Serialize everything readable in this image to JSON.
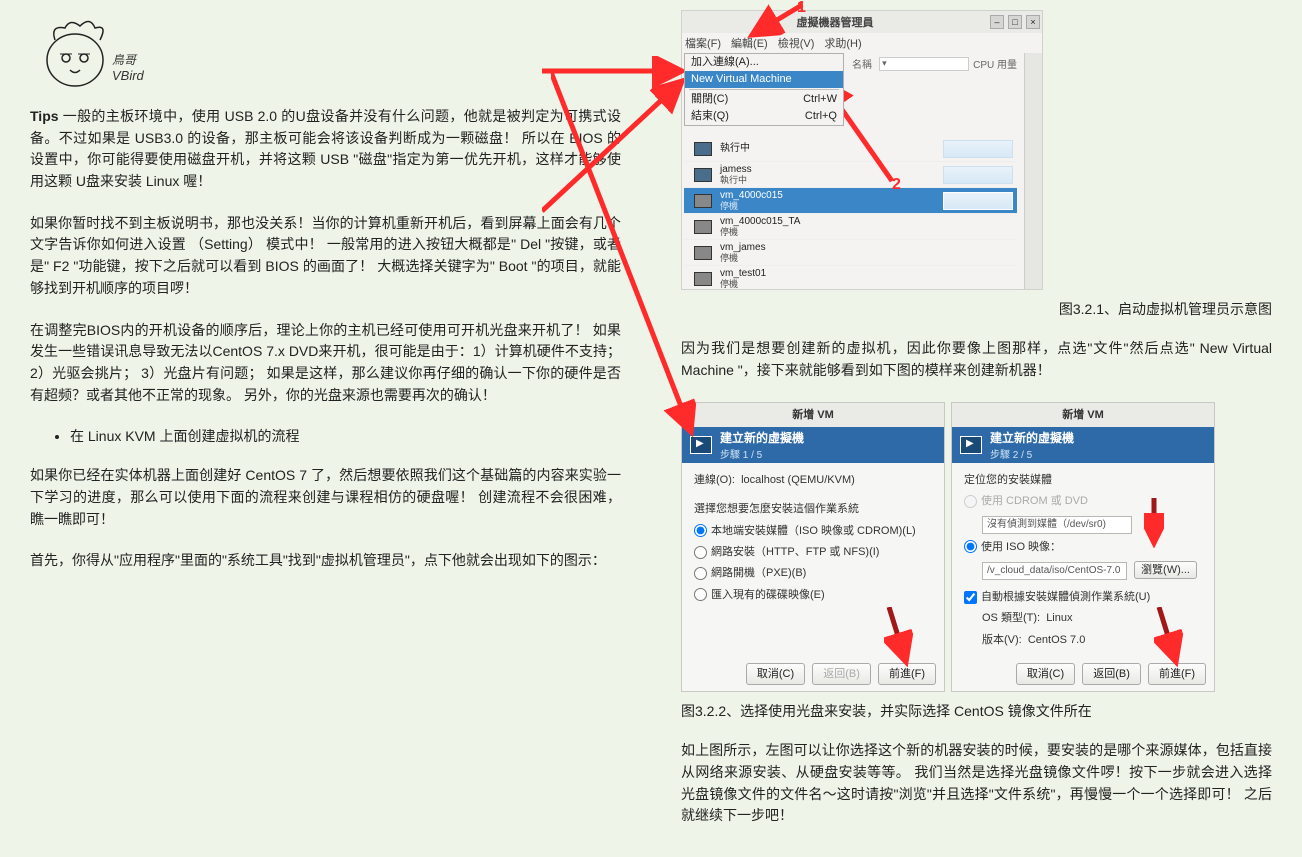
{
  "left": {
    "tips_label": "Tips",
    "p1": "一般的主板环境中，使用 USB 2.0 的U盘设备并没有什么问题，他就是被判定为可携式设备。不过如果是 USB3.0 的设备，那主板可能会将该设备判断成为一颗磁盘！ 所以在 BIOS 的设置中，你可能得要使用磁盘开机，并将这颗 USB \"磁盘\"指定为第一优先开机，这样才能够使用这颗 U盘来安装 Linux 喔！",
    "p2": "如果你暂时找不到主板说明书，那也没关系！当你的计算机重新开机后，看到屏幕上面会有几个文字告诉你如何进入设置 （Setting） 模式中！ 一般常用的进入按钮大概都是\" Del \"按键，或者是\" F2 \"功能键，按下之后就可以看到 BIOS 的画面了！ 大概选择关键字为\" Boot \"的项目，就能够找到开机顺序的项目啰！",
    "p3": "在调整完BIOS内的开机设备的顺序后，理论上你的主机已经可使用可开机光盘来开机了！ 如果发生一些错误讯息导致无法以CentOS 7.x DVD来开机，很可能是由于：1）计算机硬件不支持； 2）光驱会挑片； 3）光盘片有问题； 如果是这样，那么建议你再仔细的确认一下你的硬件是否有超频？或者其他不正常的现象。 另外，你的光盘来源也需要再次的确认！",
    "bullet1": "在 Linux KVM 上面创建虚拟机的流程",
    "p4": "如果你已经在实体机器上面创建好 CentOS 7 了，然后想要依照我们这个基础篇的内容来实验一下学习的进度，那么可以使用下面的流程来创建与课程相仿的硬盘喔！ 创建流程不会很困难，瞧一瞧即可！",
    "p5": "首先，你得从\"应用程序\"里面的\"系统工具\"找到\"虚拟机管理员\"，点下他就会出现如下的图示："
  },
  "fig321": {
    "window_title": "虛擬機器管理員",
    "menu": {
      "file": "檔案(F)",
      "edit": "編輯(E)",
      "view": "檢視(V)",
      "help": "求助(H)"
    },
    "dd": {
      "add": "加入連線(A)...",
      "new": "New Virtual Machine",
      "close": "關閉(C)",
      "close_k": "Ctrl+W",
      "quit": "結束(Q)",
      "quit_k": "Ctrl+Q"
    },
    "col_name": "名稱",
    "col_cpu": "CPU 用量",
    "vms": [
      {
        "name": "執行中",
        "state": ""
      },
      {
        "name": "jamess",
        "state": "執行中"
      },
      {
        "name": "vm_4000c015",
        "state": "停機"
      },
      {
        "name": "vm_4000c015_TA",
        "state": "停機"
      },
      {
        "name": "vm_james",
        "state": "停機"
      },
      {
        "name": "vm_test01",
        "state": "停機"
      }
    ],
    "red1": "1",
    "red2": "2"
  },
  "caption321": "图3.2.1、启动虚拟机管理员示意图",
  "p_after321": "因为我们是想要创建新的虚拟机，因此你要像上图那样，点选\"文件\"然后点选\" New Virtual Machine \"，接下来就能够看到如下图的模样来创建新机器！",
  "dlg1": {
    "title": "新增 VM",
    "head": "建立新的虛擬機",
    "step": "步驟 1 / 5",
    "conn_lbl": "連線(O):",
    "conn_val": "localhost (QEMU/KVM)",
    "prompt": "選擇您想要怎麼安裝這個作業系統",
    "opt1": "本地端安裝媒體（ISO 映像或 CDROM)(L)",
    "opt2": "網路安裝（HTTP、FTP 或 NFS)(I)",
    "opt3": "網路開機（PXE)(B)",
    "opt4": "匯入現有的碟碟映像(E)",
    "btn_cancel": "取消(C)",
    "btn_back": "返回(B)",
    "btn_fwd": "前進(F)"
  },
  "dlg2": {
    "title": "新增 VM",
    "head": "建立新的虛擬機",
    "step": "步驟 2 / 5",
    "prompt": "定位您的安裝媒體",
    "opt_cd": "使用 CDROM 或 DVD",
    "cd_none": "沒有偵測到媒體（/dev/sr0)",
    "opt_iso": "使用 ISO 映像：",
    "iso_path": "/v_cloud_data/iso/CentOS-7.0",
    "browse": "瀏覽(W)...",
    "auto": "自動根據安裝媒體偵測作業系統(U)",
    "ostype_lbl": "OS 類型(T):",
    "ostype_val": "Linux",
    "ver_lbl": "版本(V):",
    "ver_val": "CentOS 7.0",
    "btn_cancel": "取消(C)",
    "btn_back": "返回(B)",
    "btn_fwd": "前進(F)"
  },
  "caption322": "图3.2.2、选择使用光盘来安装，并实际选择 CentOS 镜像文件所在",
  "p_after322": "如上图所示，左图可以让你选择这个新的机器安装的时候，要安装的是哪个来源媒体，包括直接从网络来源安装、从硬盘安装等等。 我们当然是选择光盘镜像文件啰！按下一步就会进入选择光盘镜像文件的文件名～这时请按\"浏览\"并且选择\"文件系统\"，再慢慢一个一个选择即可！ 之后就继续下一步吧！"
}
